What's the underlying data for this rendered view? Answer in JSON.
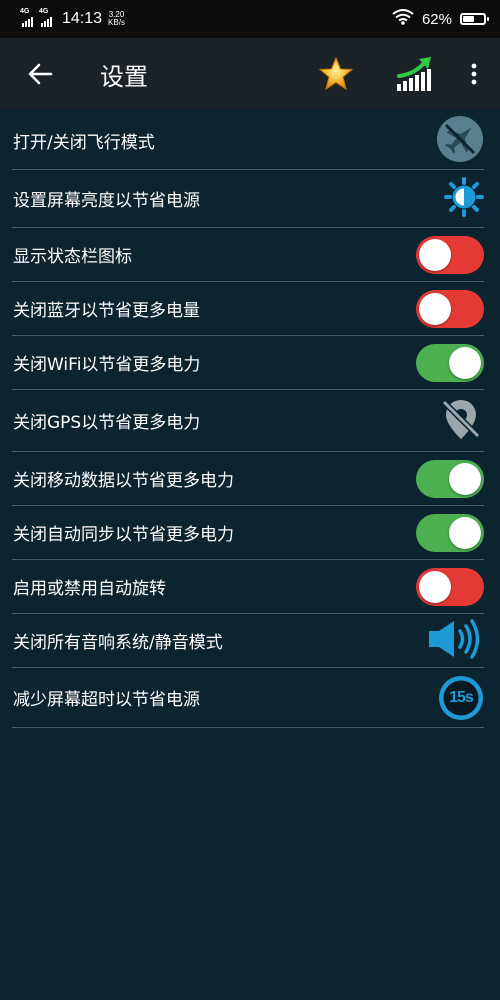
{
  "status_bar": {
    "sim1": "4G",
    "sim2": "4G",
    "time": "14:13",
    "speed_value": "3.20",
    "speed_unit": "KB/s",
    "battery_text": "62%",
    "battery_level": 0.62
  },
  "app_bar": {
    "back_icon": "arrow-left-icon",
    "title": "设置",
    "star_icon": "star-icon",
    "boost_icon": "signal-boost-icon",
    "more_icon": "more-vert-icon"
  },
  "colors": {
    "background": "#0c2430",
    "app_bar": "#1c2328",
    "toggle_on": "#4caf50",
    "toggle_off": "#e53935",
    "accent_blue": "#1e9ad6"
  },
  "settings": [
    {
      "label": "打开/关闭飞行模式",
      "control": "airplane-mode-off-icon"
    },
    {
      "label": "设置屏幕亮度以节省电源",
      "control": "brightness-icon"
    },
    {
      "label": "显示状态栏图标",
      "control": "toggle",
      "on": false
    },
    {
      "label": "关闭蓝牙以节省更多电量",
      "control": "toggle",
      "on": false
    },
    {
      "label": "关闭WiFi以节省更多电力",
      "control": "toggle",
      "on": true
    },
    {
      "label": "关闭GPS以节省更多电力",
      "control": "gps-off-icon"
    },
    {
      "label": "关闭移动数据以节省更多电力",
      "control": "toggle",
      "on": true
    },
    {
      "label": "关闭自动同步以节省更多电力",
      "control": "toggle",
      "on": true
    },
    {
      "label": "启用或禁用自动旋转",
      "control": "toggle",
      "on": false
    },
    {
      "label": "关闭所有音响系统/静音模式",
      "control": "volume-icon"
    },
    {
      "label": "减少屏幕超时以节省电源",
      "control": "screen-timeout-icon",
      "text": "15s"
    }
  ]
}
